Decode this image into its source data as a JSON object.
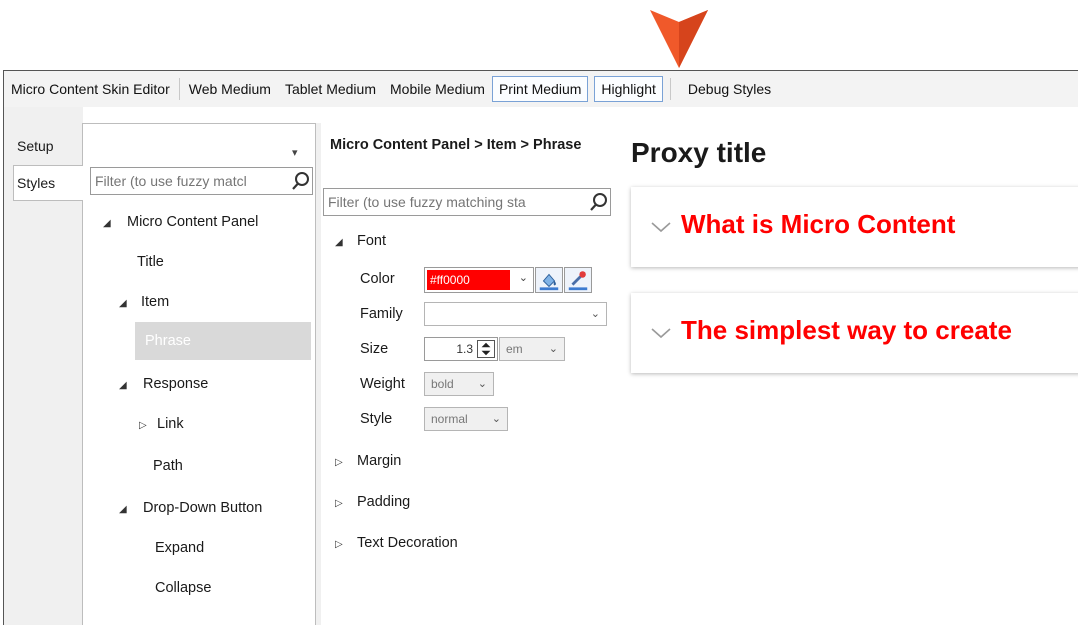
{
  "colors": {
    "accent": "#ff0000",
    "callout": "#f0592a"
  },
  "toolbar": {
    "items": [
      "Micro Content Skin Editor",
      "Web Medium",
      "Tablet Medium",
      "Mobile Medium",
      "Print Medium",
      "Highlight",
      "Debug Styles"
    ]
  },
  "tabs": {
    "setup": "Setup",
    "styles": "Styles"
  },
  "tree": {
    "filter_placeholder": "Filter (to use fuzzy matcl",
    "nodes": [
      "Micro Content Panel",
      "Title",
      "Item",
      "Phrase",
      "Response",
      "Link",
      "Path",
      "Drop-Down Button",
      "Expand",
      "Collapse"
    ]
  },
  "props": {
    "breadcrumb": "Micro Content Panel > Item > Phrase",
    "filter_placeholder": "Filter (to use fuzzy matching sta",
    "font_group": "Font",
    "labels": {
      "color": "Color",
      "family": "Family",
      "size": "Size",
      "weight": "Weight",
      "style": "Style"
    },
    "values": {
      "color": "#ff0000",
      "family": "",
      "size": "1.3",
      "size_unit": "em",
      "weight": "bold",
      "style": "normal"
    },
    "groups": [
      "Margin",
      "Padding",
      "Text Decoration"
    ]
  },
  "preview": {
    "title": "Proxy title",
    "items": [
      "What is Micro Content",
      "The simplest way to create"
    ]
  }
}
